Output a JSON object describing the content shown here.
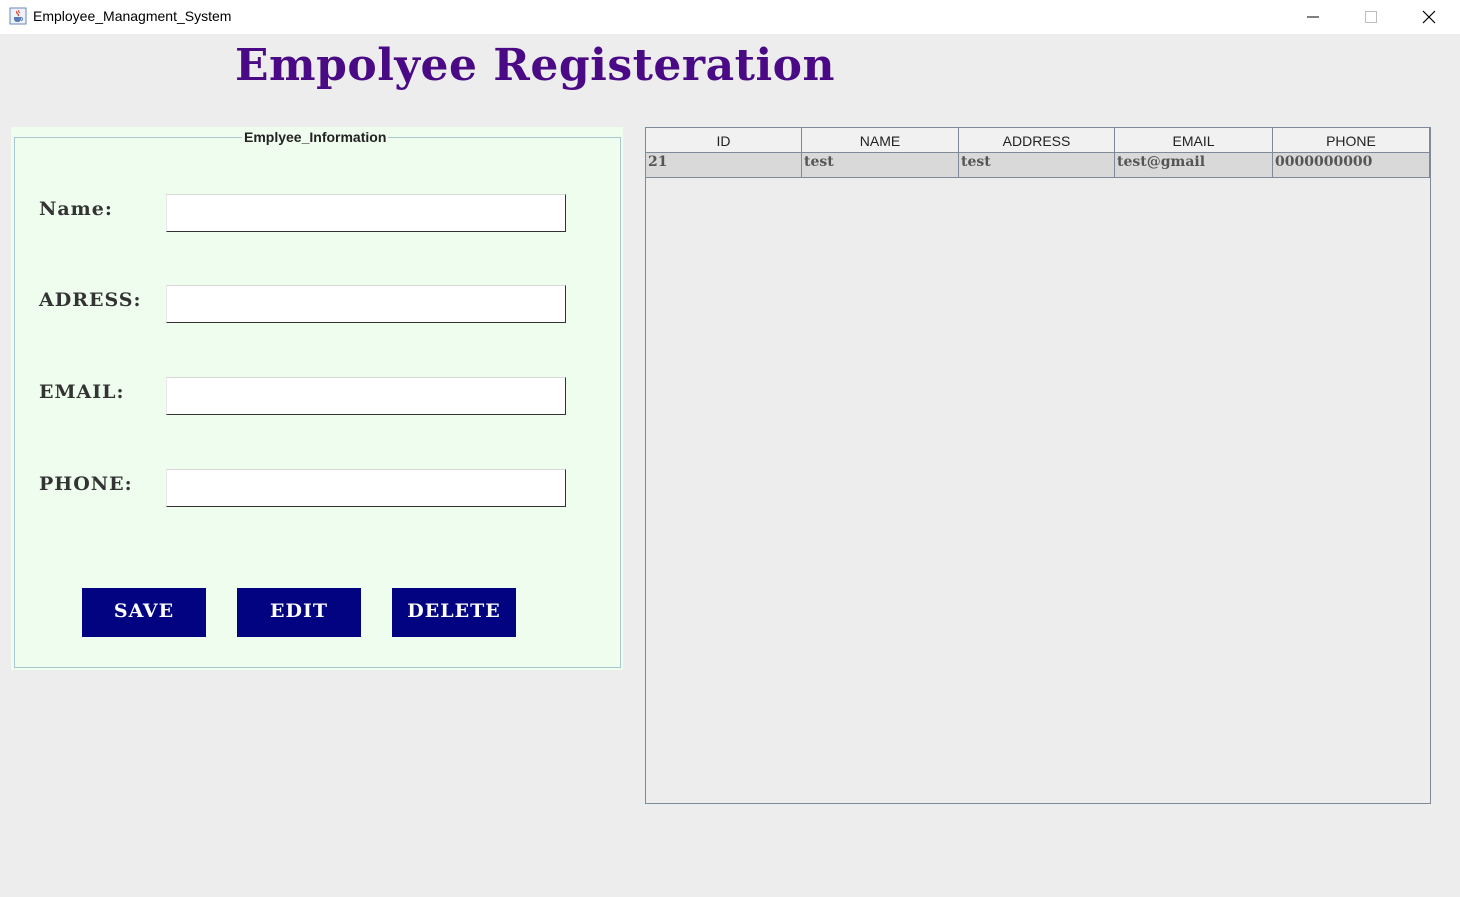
{
  "window": {
    "title": "Employee_Managment_System",
    "icon": "java-cup-icon"
  },
  "page": {
    "title": "Empolyee Registeration"
  },
  "form": {
    "legend": "Emplyee_Information",
    "fields": [
      {
        "label": "Name:",
        "value": ""
      },
      {
        "label": "ADRESS:",
        "value": ""
      },
      {
        "label": "EMAIL:",
        "value": ""
      },
      {
        "label": "PHONE:",
        "value": ""
      }
    ],
    "buttons": {
      "save": "SAVE",
      "edit": "EDIT",
      "delete": "DELETE"
    },
    "colors": {
      "button_bg": "#020381",
      "panel_bg": "#effdef",
      "title": "#4b0a85"
    }
  },
  "table": {
    "columns": [
      "ID",
      "NAME",
      "ADDRESS",
      "EMAIL",
      "PHONE"
    ],
    "rows": [
      [
        "21",
        "test",
        "test",
        "test@gmail",
        "0000000000"
      ]
    ]
  }
}
